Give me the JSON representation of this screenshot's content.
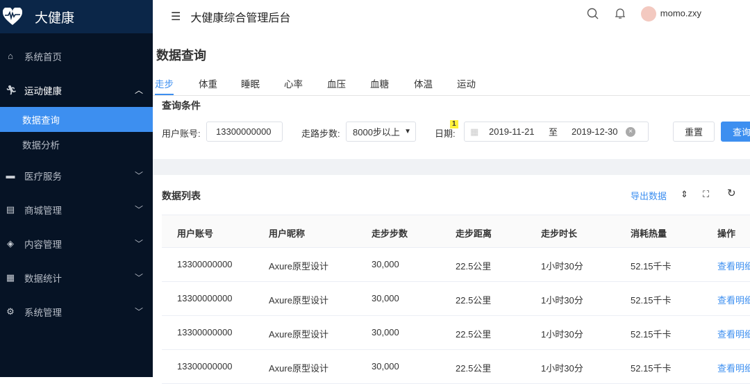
{
  "app": {
    "logo_text": "大健康",
    "header_title": "大健康综合管理后台",
    "user_name": "momo.zxy"
  },
  "sidebar": {
    "items": [
      {
        "label": "系统首页",
        "icon": "home-icon"
      },
      {
        "label": "运动健康",
        "icon": "running-icon",
        "expanded": true,
        "children": [
          {
            "label": "数据查询",
            "active": true
          },
          {
            "label": "数据分析"
          }
        ]
      },
      {
        "label": "医疗服务",
        "icon": "medical-icon"
      },
      {
        "label": "商城管理",
        "icon": "shop-icon"
      },
      {
        "label": "内容管理",
        "icon": "box-icon"
      },
      {
        "label": "数据统计",
        "icon": "chart-icon"
      },
      {
        "label": "系统管理",
        "icon": "gear-icon"
      }
    ]
  },
  "page": {
    "title": "数据查询"
  },
  "tabs": [
    "走步",
    "体重",
    "睡眠",
    "心率",
    "血压",
    "血糖",
    "体温",
    "运动"
  ],
  "query": {
    "title": "查询条件",
    "account_label": "用户账号:",
    "account_value": "13300000000",
    "steps_label": "走路步数:",
    "steps_value": "8000步以上",
    "date_label": "日期:",
    "date_badge": "1",
    "date_start": "2019-11-21",
    "date_sep": "至",
    "date_end": "2019-12-30",
    "reset": "重置",
    "search": "查询"
  },
  "list": {
    "title": "数据列表",
    "export": "导出数据",
    "columns": [
      "用户账号",
      "用户昵称",
      "走步步数",
      "走步距离",
      "走步时长",
      "消耗热量",
      "操作"
    ],
    "rows": [
      [
        "13300000000",
        "Axure原型设计",
        "30,000",
        "22.5公里",
        "1小时30分",
        "52.15千卡",
        "查看明细"
      ],
      [
        "13300000000",
        "Axure原型设计",
        "30,000",
        "22.5公里",
        "1小时30分",
        "52.15千卡",
        "查看明细"
      ],
      [
        "13300000000",
        "Axure原型设计",
        "30,000",
        "22.5公里",
        "1小时30分",
        "52.15千卡",
        "查看明细"
      ],
      [
        "13300000000",
        "Axure原型设计",
        "30,000",
        "22.5公里",
        "1小时30分",
        "52.15千卡",
        "查看明细"
      ]
    ]
  },
  "colors": {
    "accent": "#3d8ff0",
    "sidebar": "#061325",
    "logo_bg": "#0b2648"
  }
}
